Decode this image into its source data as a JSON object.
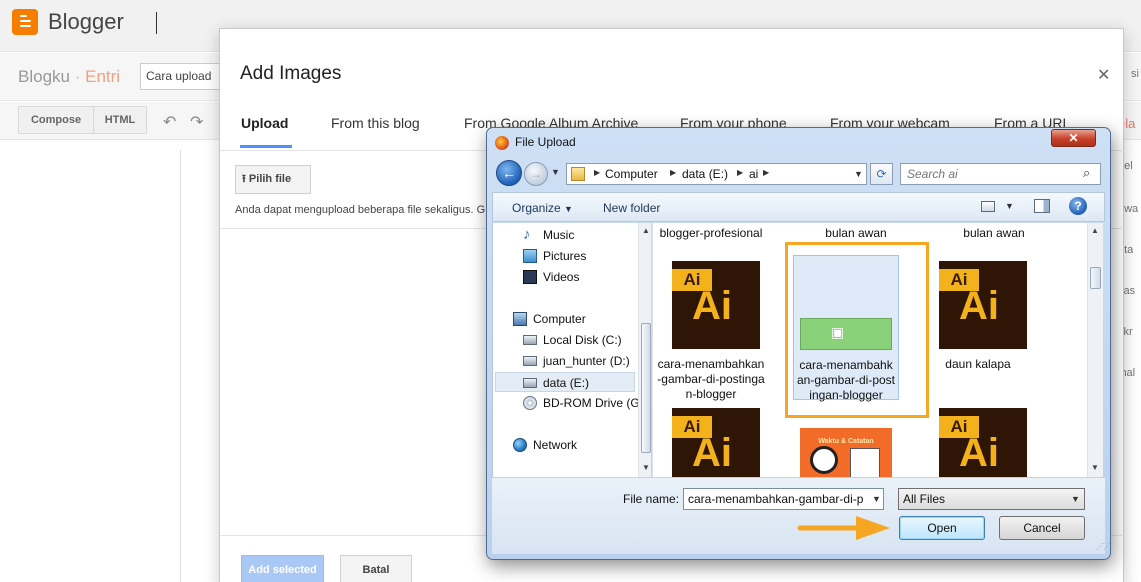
{
  "app": {
    "name": "Blogger",
    "blog_name": "Blogku",
    "separator": "·",
    "section": "Entri"
  },
  "post": {
    "title_value": "Cara upload"
  },
  "toolbar": {
    "compose_label": "Compose",
    "html_label": "HTML"
  },
  "right_edge": [
    "si",
    "ela",
    "bel",
    "dwa",
    "uta",
    "kas",
    "skr",
    "ihal"
  ],
  "modal": {
    "title": "Add Images",
    "tabs": [
      {
        "label": "Upload"
      },
      {
        "label": "From this blog"
      },
      {
        "label": "From Google Album Archive"
      },
      {
        "label": "From your phone"
      },
      {
        "label": "From your webcam"
      },
      {
        "label": "From a URL"
      }
    ],
    "choose_file_label": "Pilih file",
    "upload_note": "Anda dapat mengupload beberapa file sekaligus. G",
    "add_selected_label": "Add selected",
    "cancel_label": "Batal"
  },
  "dialog": {
    "title": "File Upload",
    "breadcrumb": [
      "Computer",
      "data (E:)",
      "ai"
    ],
    "search_placeholder": "Search ai",
    "organize_label": "Organize",
    "new_folder_label": "New folder",
    "nav_items": [
      {
        "label": "Music",
        "icon": "music-icon"
      },
      {
        "label": "Pictures",
        "icon": "pictures-icon"
      },
      {
        "label": "Videos",
        "icon": "videos-icon"
      },
      {
        "label": "Computer",
        "icon": "computer-icon"
      },
      {
        "label": "Local Disk (C:)",
        "icon": "drive-icon"
      },
      {
        "label": "juan_hunter (D:)",
        "icon": "drive-icon"
      },
      {
        "label": "data (E:)",
        "icon": "drive-icon"
      },
      {
        "label": "BD-ROM Drive (G",
        "icon": "disc-icon"
      },
      {
        "label": "Network",
        "icon": "network-icon"
      }
    ],
    "files_top_row": [
      "blogger-profesional",
      "bulan awan",
      "bulan awan"
    ],
    "files": [
      {
        "label": "cara-menambahkan-gambar-di-postingan-blogger",
        "type": "ai"
      },
      {
        "label": "cara-menambahkan-gambar-di-postingan-blogger",
        "type": "image",
        "selected": true
      },
      {
        "label": "daun kalapa",
        "type": "ai"
      }
    ],
    "ai_badge": "Ai",
    "orange_thumb_title": "Waktu & Catatan",
    "file_name_label": "File name:",
    "file_name_value": "cara-menambahkan-gambar-di-p",
    "filter_value": "All Files",
    "open_label": "Open",
    "cancel_label": "Cancel"
  },
  "colors": {
    "highlight": "#f5a623",
    "blogger_orange": "#f57d00",
    "link_blue": "#4d90fe"
  }
}
